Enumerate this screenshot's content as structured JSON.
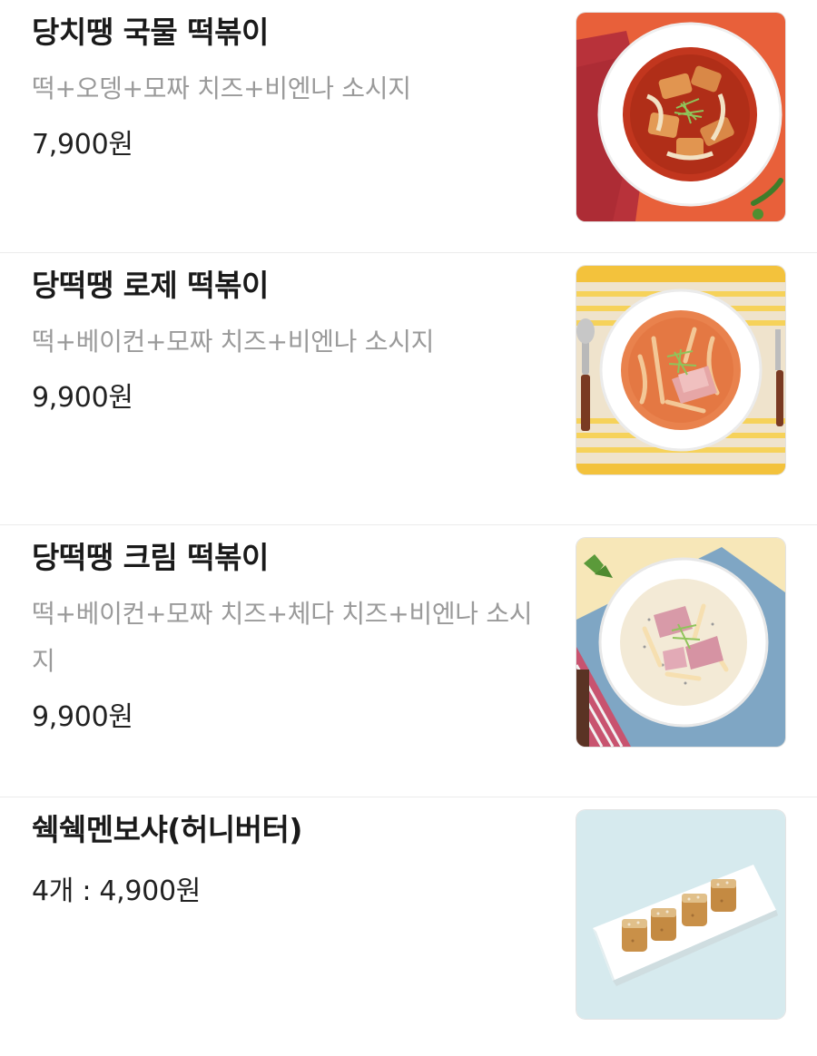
{
  "menu": {
    "items": [
      {
        "name": "당치땡 국물 떡볶이",
        "description": "떡+오뎅+모짜 치즈+비엔나 소시지",
        "price": "7,900원",
        "image_icon": "soup-tteokbokki-photo"
      },
      {
        "name": "당떡땡 로제 떡볶이",
        "description": "떡+베이컨+모짜 치즈+비엔나 소시지",
        "price": "9,900원",
        "image_icon": "rose-tteokbokki-photo"
      },
      {
        "name": "당떡땡 크림 떡볶이",
        "description": "떡+베이컨+모짜 치즈+체다 치즈+비엔나 소시지",
        "price": "9,900원",
        "image_icon": "cream-tteokbokki-photo"
      },
      {
        "name": "쉑쉑멘보샤(허니버터)",
        "description": "",
        "price": "4개 : 4,900원",
        "image_icon": "menbosha-photo"
      }
    ]
  },
  "colors": {
    "title": "#1a1a1a",
    "description": "#9a9a9a",
    "price": "#222222",
    "divider": "#ececec"
  }
}
